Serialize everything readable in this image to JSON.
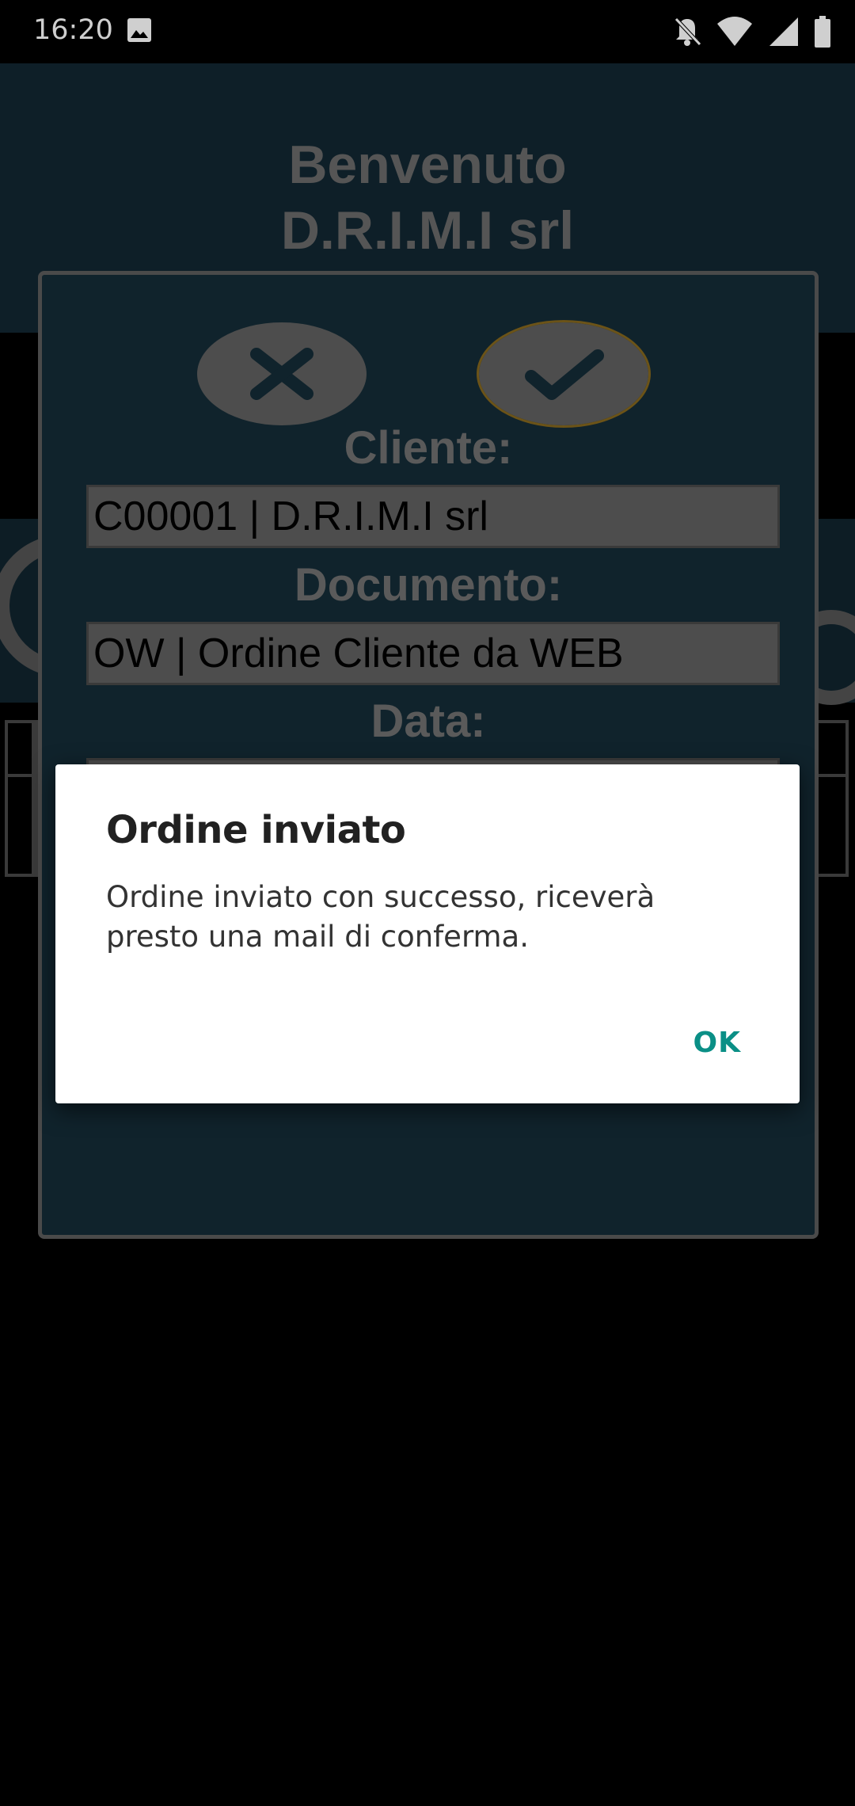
{
  "status_bar": {
    "time": "16:20",
    "icons": [
      "image-icon",
      "bell-off-icon",
      "wifi-icon",
      "signal-icon",
      "battery-icon"
    ]
  },
  "header": {
    "welcome_line1": "Benvenuto",
    "welcome_line2": "D.R.I.M.I srl"
  },
  "order_panel": {
    "cancel_icon": "close-icon",
    "confirm_icon": "check-icon",
    "cliente_label": "Cliente:",
    "cliente_value": "C00001 | D.R.I.M.I srl",
    "documento_label": "Documento:",
    "documento_value": "OW | Ordine Cliente da WEB",
    "data_label": "Data:"
  },
  "dialog": {
    "title": "Ordine inviato",
    "message": "Ordine inviato con successo, riceverà presto una mail di conferma.",
    "ok_label": "OK"
  },
  "colors": {
    "accent": "#0a8f86",
    "panel_bg": "#10232c"
  }
}
